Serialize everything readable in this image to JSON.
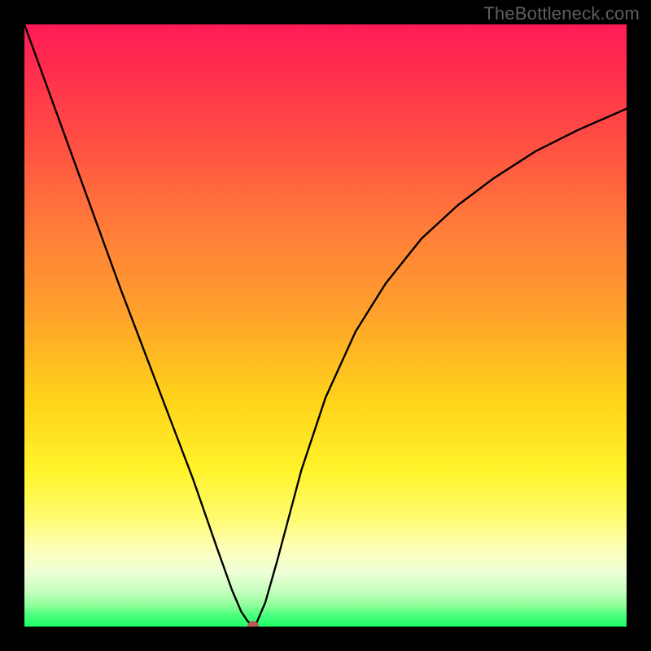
{
  "watermark": "TheBottleneck.com",
  "chart_data": {
    "type": "line",
    "title": "",
    "xlabel": "",
    "ylabel": "",
    "xlim": [
      0,
      100
    ],
    "ylim": [
      0,
      100
    ],
    "grid": false,
    "background_gradient": {
      "top": "#ff1a57",
      "mid_upper": "#ff7a3a",
      "mid": "#ffd21a",
      "mid_lower": "#fdffb8",
      "bottom": "#1dff66"
    },
    "marker": {
      "x": 38,
      "y": 0,
      "color": "#b85a57"
    },
    "series": [
      {
        "name": "bottleneck-curve",
        "color": "#000000",
        "x": [
          0,
          4,
          8,
          12,
          16,
          20,
          24,
          28,
          32,
          34.5,
          36,
          37,
          38,
          38.5,
          40,
          42,
          46,
          50,
          55,
          60,
          66,
          72,
          78,
          85,
          92,
          100
        ],
        "y": [
          100,
          89,
          78,
          67,
          56,
          45.5,
          35,
          24.5,
          13,
          6,
          2.5,
          1,
          0,
          0.5,
          4,
          11,
          26,
          38,
          49,
          57,
          64.5,
          70,
          74.5,
          79,
          82.5,
          86
        ]
      }
    ]
  }
}
